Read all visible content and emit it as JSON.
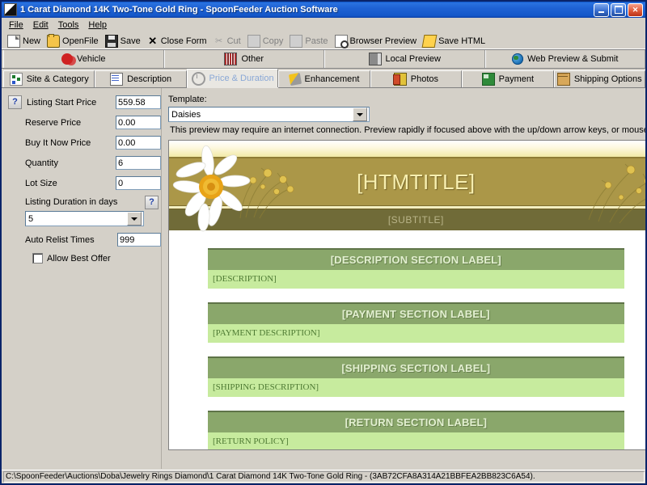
{
  "window": {
    "title": "1 Carat Diamond 14K Two-Tone Gold Ring - SpoonFeeder Auction Software",
    "app_icon": "app-icon",
    "minimize_label": "",
    "maximize_label": "",
    "close_label": "✕"
  },
  "menu": {
    "items": [
      {
        "label": "File"
      },
      {
        "label": "Edit"
      },
      {
        "label": "Tools"
      },
      {
        "label": "Help"
      }
    ]
  },
  "toolbar": {
    "buttons": [
      {
        "label": "New",
        "icon": "new-document-icon",
        "enabled": true
      },
      {
        "label": "OpenFile",
        "icon": "open-folder-icon",
        "enabled": true
      },
      {
        "label": "Save",
        "icon": "floppy-disk-icon",
        "enabled": true
      },
      {
        "label": "Close Form",
        "icon": "close-x-icon",
        "enabled": true
      },
      {
        "label": "Cut",
        "icon": "scissors-icon",
        "enabled": false
      },
      {
        "label": "Copy",
        "icon": "copy-icon",
        "enabled": false
      },
      {
        "label": "Paste",
        "icon": "paste-icon",
        "enabled": false
      },
      {
        "label": "Browser Preview",
        "icon": "magnifier-page-icon",
        "enabled": true
      },
      {
        "label": "Save HTML",
        "icon": "save-html-icon",
        "enabled": true
      }
    ]
  },
  "tabs_top": [
    {
      "label": "Vehicle",
      "icon": "vehicle-icon",
      "active": false
    },
    {
      "label": "Other",
      "icon": "barcode-icon",
      "active": false
    },
    {
      "label": "Local Preview",
      "icon": "book-icon",
      "active": false
    },
    {
      "label": "Web Preview & Submit",
      "icon": "globe-icon",
      "active": false
    }
  ],
  "tabs_main": [
    {
      "label": "Site & Category",
      "icon": "sitemap-icon",
      "active": false
    },
    {
      "label": "Description",
      "icon": "notepad-pencil-icon",
      "active": false
    },
    {
      "label": "Price & Duration",
      "icon": "clock-icon",
      "active": true
    },
    {
      "label": "Enhancement",
      "icon": "magic-wand-icon",
      "active": false
    },
    {
      "label": "Photos",
      "icon": "photos-icon",
      "active": false
    },
    {
      "label": "Payment",
      "icon": "payment-icon",
      "active": false
    },
    {
      "label": "Shipping Options",
      "icon": "package-box-icon",
      "active": false
    }
  ],
  "form": {
    "help_glyph": "?",
    "fields": [
      {
        "label": "Listing Start Price",
        "value": "559.58",
        "help": true
      },
      {
        "label": "Reserve Price",
        "value": "0.00",
        "help": false
      },
      {
        "label": "Buy It Now Price",
        "value": "0.00",
        "help": false
      },
      {
        "label": "Quantity",
        "value": "6",
        "help": false
      },
      {
        "label": "Lot Size",
        "value": "0",
        "help": false
      }
    ],
    "duration": {
      "label": "Listing Duration in days",
      "value": "5",
      "help": "?"
    },
    "auto_relist": {
      "label": "Auto Relist Times",
      "value": "999"
    },
    "allow_best_offer": {
      "label": "Allow Best Offer",
      "checked": false
    }
  },
  "preview": {
    "template_label": "Template:",
    "template_value": "Daisies",
    "hint": "This preview may require an internet connection. Preview rapidly if focused above with the up/down arrow keys, or mouse wheel.",
    "scroll_up_icon": "chevron-up-icon",
    "scroll_down_icon": "chevron-down-icon"
  },
  "document": {
    "title": "[HTMTITLE]",
    "subtitle": "[SUBTITLE]",
    "colors": {
      "gold": "#ab9748",
      "olive": "#706b38",
      "section_header": "#8aa76b",
      "section_body": "#c7eb9e",
      "title_text": "#f7efb0",
      "body_text": "#4e7a33"
    },
    "sections": [
      {
        "header": "[DESCRIPTION SECTION LABEL]",
        "body": "[DESCRIPTION]"
      },
      {
        "header": "[PAYMENT SECTION LABEL]",
        "body": "[PAYMENT DESCRIPTION]"
      },
      {
        "header": "[SHIPPING SECTION LABEL]",
        "body": "[SHIPPING DESCRIPTION]"
      },
      {
        "header": "[RETURN SECTION LABEL]",
        "body": "[RETURN POLICY]"
      }
    ]
  },
  "statusbar": {
    "path": "C:\\SpoonFeeder\\Auctions\\Doba\\Jewelry Rings Diamond\\1 Carat Diamond 14K Two-Tone Gold Ring - (3AB72CFA8A314A21BBFEA2BB823C6A54)."
  }
}
